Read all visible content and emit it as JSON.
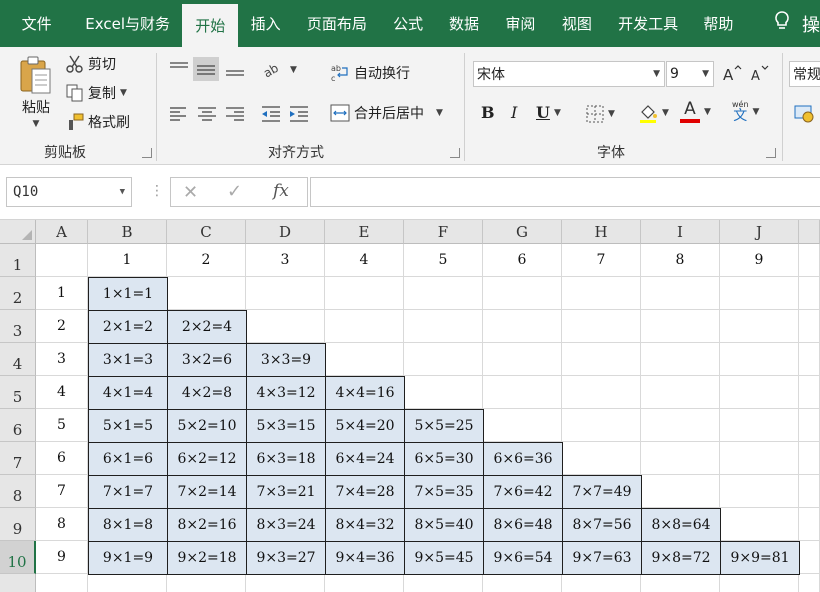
{
  "menu": {
    "tabs": [
      "文件",
      "Excel与财务",
      "开始",
      "插入",
      "页面布局",
      "公式",
      "数据",
      "审阅",
      "视图",
      "开发工具",
      "帮助"
    ],
    "active_tab": "开始",
    "tell_me_partial": "操"
  },
  "ribbon": {
    "clipboard": {
      "paste": "粘贴",
      "cut": "剪切",
      "copy": "复制",
      "format_painter": "格式刷",
      "group_label": "剪贴板"
    },
    "alignment": {
      "wrap_text": "自动换行",
      "merge_center": "合并后居中",
      "group_label": "对齐方式"
    },
    "font": {
      "font_name": "宋体",
      "font_size": "9",
      "bold": "B",
      "italic": "I",
      "underline": "U",
      "font_color_letter": "A",
      "font_color": "#e00000",
      "phonetic": "wén",
      "phonetic_char": "文",
      "group_label": "字体"
    },
    "number": {
      "format_partial": "常规"
    }
  },
  "formula_bar": {
    "name_box": "Q10",
    "fx": "fx",
    "formula": ""
  },
  "sheet": {
    "columns": [
      "A",
      "B",
      "C",
      "D",
      "E",
      "F",
      "G",
      "H",
      "I",
      "J"
    ],
    "rows": [
      "1",
      "2",
      "3",
      "4",
      "5",
      "6",
      "7",
      "8",
      "9",
      "10"
    ],
    "selected_row": "10",
    "header_row": [
      "1",
      "2",
      "3",
      "4",
      "5",
      "6",
      "7",
      "8",
      "9"
    ],
    "row_labels": [
      "1",
      "2",
      "3",
      "4",
      "5",
      "6",
      "7",
      "8",
      "9"
    ],
    "table": [
      [
        "1×1=1"
      ],
      [
        "2×1=2",
        "2×2=4"
      ],
      [
        "3×1=3",
        "3×2=6",
        "3×3=9"
      ],
      [
        "4×1=4",
        "4×2=8",
        "4×3=12",
        "4×4=16"
      ],
      [
        "5×1=5",
        "5×2=10",
        "5×3=15",
        "5×4=20",
        "5×5=25"
      ],
      [
        "6×1=6",
        "6×2=12",
        "6×3=18",
        "6×4=24",
        "6×5=30",
        "6×6=36"
      ],
      [
        "7×1=7",
        "7×2=14",
        "7×3=21",
        "7×4=28",
        "7×5=35",
        "7×6=42",
        "7×7=49"
      ],
      [
        "8×1=8",
        "8×2=16",
        "8×3=24",
        "8×4=32",
        "8×5=40",
        "8×6=48",
        "8×7=56",
        "8×8=64"
      ],
      [
        "9×1=9",
        "9×2=18",
        "9×3=27",
        "9×4=36",
        "9×5=45",
        "9×6=54",
        "9×7=63",
        "9×8=72",
        "9×9=81"
      ]
    ],
    "product_fill": "#dce6f1"
  }
}
